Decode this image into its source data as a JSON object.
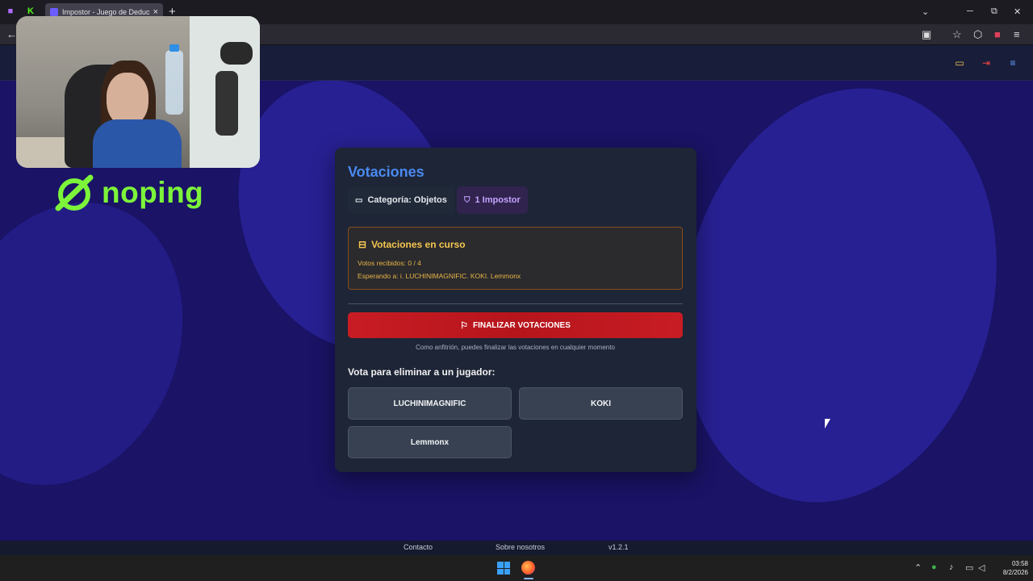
{
  "browser": {
    "tab_title": "Impostor - Juego de Deducción",
    "tab_close": "×",
    "new_tab": "+",
    "nav_back": "←",
    "window_controls": [
      "⌄",
      "─",
      "⧉",
      "✕"
    ],
    "toolbar_icons": [
      "reader-icon",
      "star-icon",
      "extensions-icon",
      "menu-icon"
    ]
  },
  "page": {
    "card": {
      "title": "Votaciones",
      "category_chip": "Categoría: Objetos",
      "impostor_chip": "1 Impostor",
      "status": {
        "title": "Votaciones en curso",
        "votes_received": "Votos recibidos: 0 / 4",
        "waiting_for": "Esperando a: i. LUCHINIMAGNIFIC. KOKI. Lemmonx"
      },
      "finalize_button": "FINALIZAR VOTACIONES",
      "finalize_hint": "Como anfitrión, puedes finalizar las votaciones en cualquier momento",
      "vote_label": "Vota para eliminar a un jugador:",
      "players": [
        "LUCHINIMAGNIFIC",
        "KOKI",
        "Lemmonx"
      ]
    },
    "footer": {
      "contact": "Contacto",
      "about": "Sobre nosotros",
      "version": "v1.2.1"
    }
  },
  "overlay": {
    "logo_text": "noping"
  },
  "taskbar": {
    "time": "03:58",
    "date": "8/2/2026"
  },
  "colors": {
    "page_bg": "#1a1366",
    "card_bg": "#1d2536",
    "title_blue": "#4b89f0",
    "finalize_red": "#c81c24",
    "status_amber": "#f5c74f",
    "logo_green": "#7cf43a"
  }
}
